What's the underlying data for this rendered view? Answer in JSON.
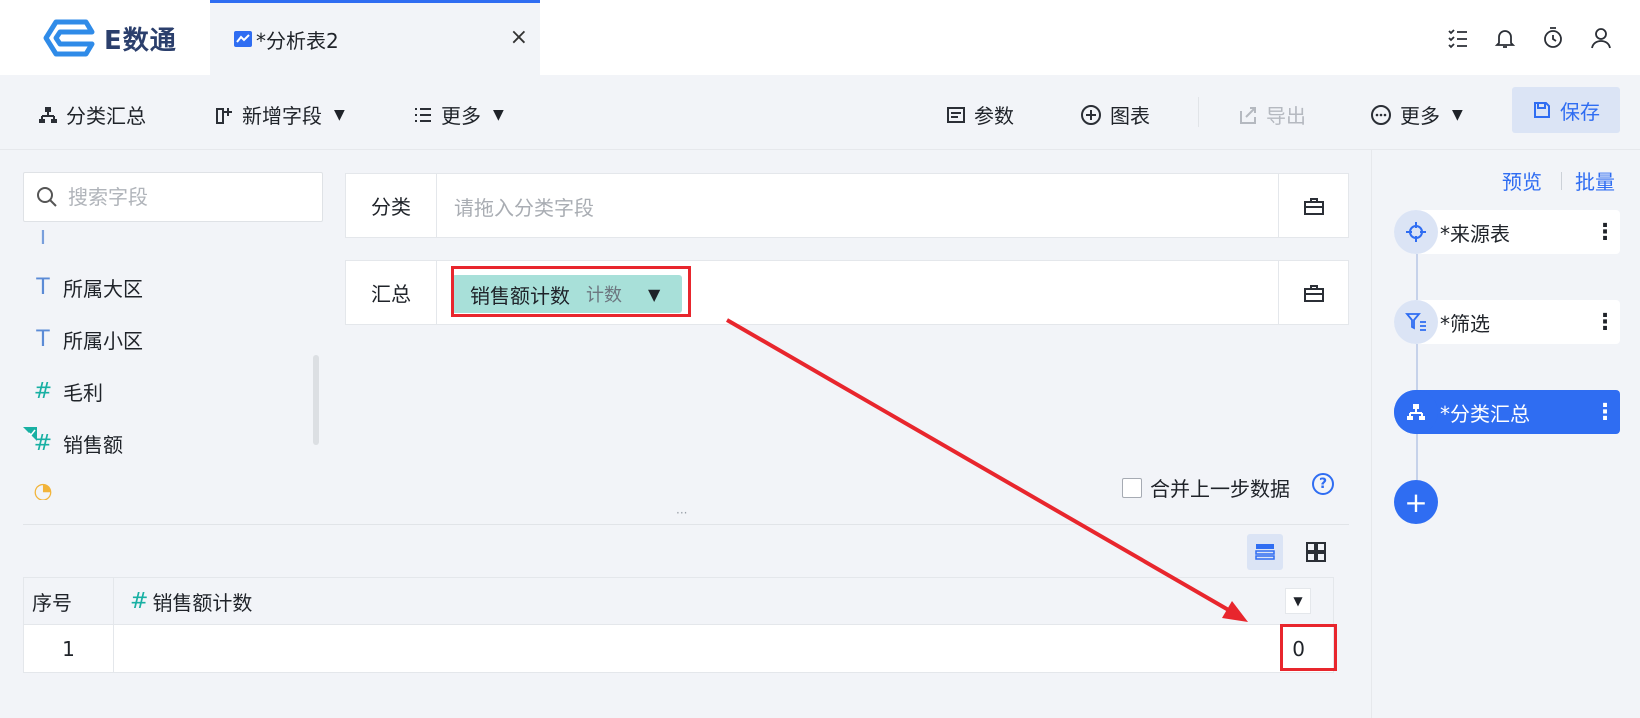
{
  "app": {
    "logo_text": "E数通"
  },
  "tab": {
    "title": "*分析表2",
    "close": "×"
  },
  "toolbar": {
    "group": "分类汇总",
    "add_field": "新增字段",
    "more_left": "更多",
    "params": "参数",
    "chart": "图表",
    "export": "导出",
    "more_right": "更多",
    "save": "保存"
  },
  "left": {
    "search_placeholder": "搜索字段",
    "fields": [
      {
        "type": "T",
        "name": "所属大区"
      },
      {
        "type": "T",
        "name": "所属小区"
      },
      {
        "type": "#",
        "name": "毛利"
      },
      {
        "type": "#",
        "name": "销售额"
      }
    ]
  },
  "config": {
    "category_label": "分类",
    "category_placeholder": "请拖入分类字段",
    "summary_label": "汇总",
    "summary_pill": {
      "name": "销售额计数",
      "agg": "计数"
    },
    "merge_label": "合并上一步数据",
    "help": "?",
    "dots": "···"
  },
  "table": {
    "col_index": "序号",
    "col_hash": "#",
    "col_name": "销售额计数",
    "rows": [
      {
        "index": "1",
        "value": "0"
      }
    ]
  },
  "right": {
    "preview": "预览",
    "batch": "批量",
    "steps": [
      {
        "label": "*来源表",
        "menu": "⋮"
      },
      {
        "label": "*筛选",
        "menu": "⋮"
      },
      {
        "label": "*分类汇总",
        "menu": "⋮"
      }
    ],
    "add": "+"
  },
  "colors": {
    "accent": "#2f6df2",
    "highlight": "#e8262d",
    "pill": "#a8e0d9",
    "number_icon": "#18b0a3"
  }
}
